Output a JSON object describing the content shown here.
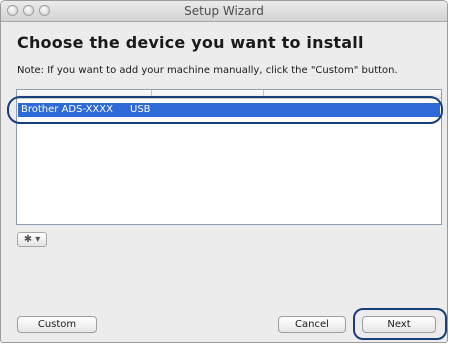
{
  "window": {
    "title": "Setup Wizard"
  },
  "heading": "Choose the device you want to install",
  "note": "Note: If you want to add your machine manually, click the \"Custom\" button.",
  "devices": [
    {
      "name": "Brother ADS-XXXX",
      "connection": "USB",
      "selected": true
    }
  ],
  "action_menu": {
    "label": "✱ ▾"
  },
  "buttons": {
    "custom": "Custom",
    "cancel": "Cancel",
    "next": "Next"
  },
  "colors": {
    "selection": "#2d6ad8",
    "highlight_outline": "#183f7a"
  }
}
